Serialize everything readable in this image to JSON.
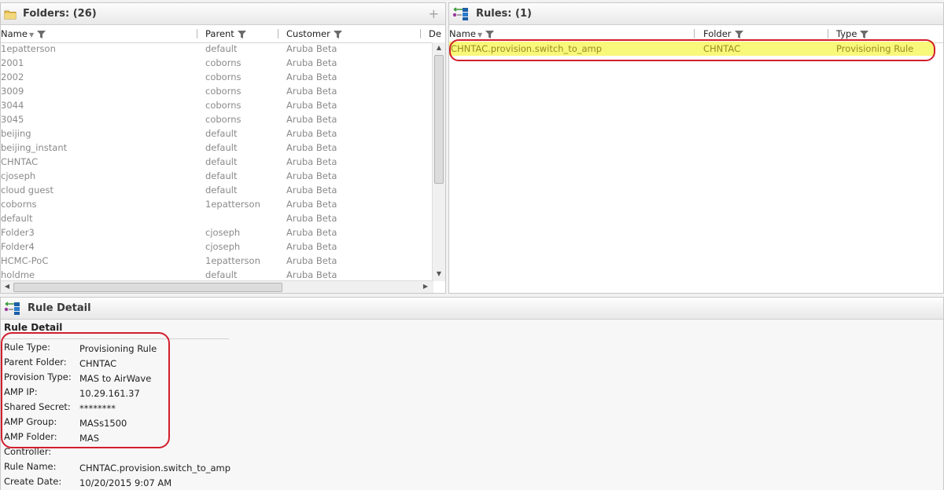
{
  "folders_panel": {
    "title": "Folders: (26)",
    "add_label": "+",
    "columns": [
      "Name",
      "Parent",
      "Customer",
      "De"
    ],
    "rows": [
      {
        "name": "1epatterson",
        "parent": "default",
        "customer": "Aruba Beta"
      },
      {
        "name": "2001",
        "parent": "coborns",
        "customer": "Aruba Beta"
      },
      {
        "name": "2002",
        "parent": "coborns",
        "customer": "Aruba Beta"
      },
      {
        "name": "3009",
        "parent": "coborns",
        "customer": "Aruba Beta"
      },
      {
        "name": "3044",
        "parent": "coborns",
        "customer": "Aruba Beta"
      },
      {
        "name": "3045",
        "parent": "coborns",
        "customer": "Aruba Beta"
      },
      {
        "name": "beijing",
        "parent": "default",
        "customer": "Aruba Beta"
      },
      {
        "name": "beijing_instant",
        "parent": "default",
        "customer": "Aruba Beta"
      },
      {
        "name": "CHNTAC",
        "parent": "default",
        "customer": "Aruba Beta"
      },
      {
        "name": "cjoseph",
        "parent": "default",
        "customer": "Aruba Beta"
      },
      {
        "name": "cloud guest",
        "parent": "default",
        "customer": "Aruba Beta"
      },
      {
        "name": "coborns",
        "parent": "1epatterson",
        "customer": "Aruba Beta"
      },
      {
        "name": "default",
        "parent": "",
        "customer": "Aruba Beta"
      },
      {
        "name": "Folder3",
        "parent": "cjoseph",
        "customer": "Aruba Beta"
      },
      {
        "name": "Folder4",
        "parent": "cjoseph",
        "customer": "Aruba Beta"
      },
      {
        "name": "HCMC-PoC",
        "parent": "1epatterson",
        "customer": "Aruba Beta"
      },
      {
        "name": "holdme",
        "parent": "default",
        "customer": "Aruba Beta"
      }
    ]
  },
  "rules_panel": {
    "title": "Rules: (1)",
    "columns": [
      "Name",
      "Folder",
      "Type"
    ],
    "rows": [
      {
        "name": "CHNTAC.provision.switch_to_amp",
        "folder": "CHNTAC",
        "type": "Provisioning Rule"
      }
    ]
  },
  "detail_panel": {
    "title": "Rule Detail",
    "section_title": "Rule Detail",
    "fields": [
      {
        "label": "Rule Type:",
        "value": "Provisioning Rule"
      },
      {
        "label": "Parent Folder:",
        "value": "CHNTAC"
      },
      {
        "label": "Provision Type:",
        "value": "MAS to AirWave"
      },
      {
        "label": "AMP IP:",
        "value": "10.29.161.37"
      },
      {
        "label": "Shared Secret:",
        "value": "********"
      },
      {
        "label": "AMP Group:",
        "value": "MASs1500"
      },
      {
        "label": "AMP Folder:",
        "value": "MAS"
      },
      {
        "label": "Controller:",
        "value": ""
      },
      {
        "label": "Rule Name:",
        "value": "CHNTAC.provision.switch_to_amp"
      },
      {
        "label": "Create Date:",
        "value": "10/20/2015 9:07 AM"
      }
    ]
  },
  "colors": {
    "selected_row": "#f8f87a",
    "highlight_outline": "#d21f2d",
    "muted_text": "#8a8a8a"
  },
  "icons": {
    "folders": "folder-icon",
    "rules": "rules-icon",
    "filter": "filter-funnel-icon",
    "sort": "sort-down-icon",
    "add": "plus-icon"
  }
}
